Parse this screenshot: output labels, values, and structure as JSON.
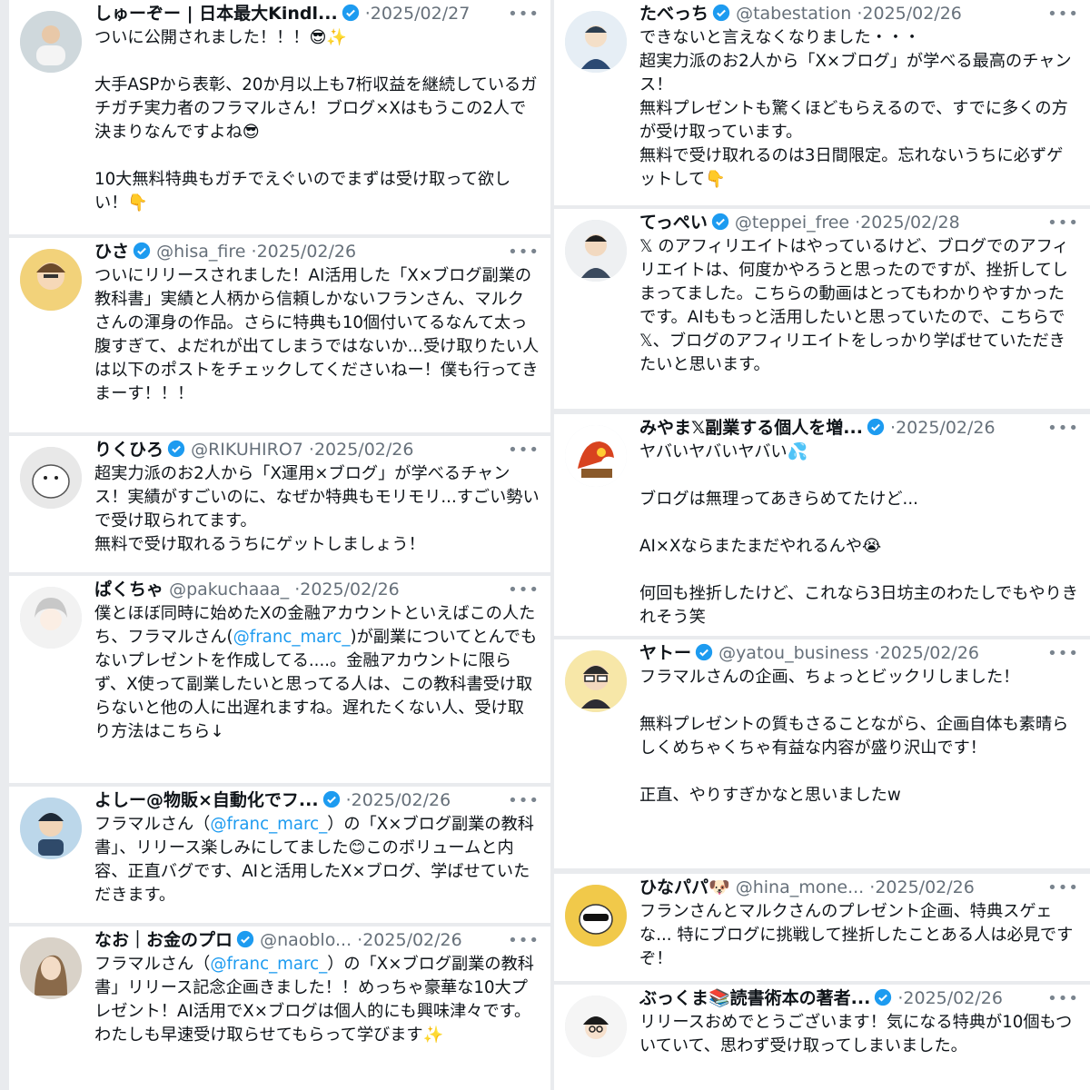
{
  "colors": {
    "verified": "#1d9bf0",
    "mention": "#1d9bf0",
    "muted": "#66707a",
    "background": "#e9ebee"
  },
  "more_icon": "•••",
  "left_tweets": [
    {
      "name": "しゅーぞー | 日本最大Kindl...",
      "handle": "",
      "dot": "·",
      "date": "2025/02/27",
      "body": "ついに公開されました！！！😎✨\n\n大手ASPから表彰、20か月以上も7桁収益を継続しているガチガチ実力者のフラマルさん！ブログ×Xはもうこの2人で決まりなんですよね😎\n\n10大無料特典もガチでえぐいのでまずは受け取って欲しい！👇"
    },
    {
      "name": "ひさ",
      "handle": "@hisa_fire",
      "dot": "·",
      "date": "2025/02/26",
      "body": "ついにリリースされました！AI活用した「X×ブログ副業の教科書」実績と人柄から信頼しかないフランさん、マルクさんの渾身の作品。さらに特典も10個付いてるなんて太っ腹すぎて、よだれが出てしまうではないか...受け取りたい人は以下のポストをチェックしてくださいねー！僕も行ってきまーす！！！"
    },
    {
      "name": "りくひろ",
      "handle": "@RIKUHIRO7",
      "dot": "·",
      "date": "2025/02/26",
      "body": "超実力派のお2人から「X運用×ブログ」が学べるチャンス！実績がすごいのに、なぜか特典もモリモリ...すごい勢いで受け取られてます。\n無料で受け取れるうちにゲットしましょう！"
    },
    {
      "name": "ぱくちゃ",
      "handle": "@pakuchaaa_",
      "dot": "·",
      "date": "2025/02/26",
      "body_pre": "僕とほぼ同時に始めたXの金融アカウントといえばこの人たち、フラマルさん(",
      "body_mention": "@franc_marc_",
      "body_post": ")が副業についてとんでもないプレゼントを作成してる....。金融アカウントに限らず、X使って副業したいと思ってる人は、この教科書受け取らないと他の人に出遅れますね。遅れたくない人、受け取り方法はこちら↓"
    },
    {
      "name": "よしー@物販×自動化でフ...",
      "handle": "",
      "dot": "·",
      "date": "2025/02/26",
      "body_pre": "フラマルさん（",
      "body_mention": "@franc_marc_",
      "body_post": "）の「X×ブログ副業の教科書」、リリース楽しみにしてました😊このボリュームと内容、正直バグです、AIと活用したX×ブログ、学ばせていただきます。"
    },
    {
      "name": "なお｜お金のプロ",
      "handle": "@naoblo...",
      "dot": "·",
      "date": "2025/02/26",
      "body_pre": "フラマルさん（",
      "body_mention": "@franc_marc_",
      "body_post": "）の「X×ブログ副業の教科書」リリース記念企画きました！！めっちゃ豪華な10大プレゼント！AI活用でX×ブログは個人的にも興味津々です。わたしも早速受け取らせてもらって学びます✨"
    }
  ],
  "right_tweets": [
    {
      "name": "たべっち",
      "handle": "@tabestation",
      "dot": "·",
      "date": "2025/02/26",
      "body": "できないと言えなくなりました・・・\n超実力派のお2人から「X×ブログ」が学べる最高のチャンス！\n無料プレゼントも驚くほどもらえるので、すでに多くの方が受け取っています。\n無料で受け取れるのは3日間限定。忘れないうちに必ずゲットして👇"
    },
    {
      "name": "てっぺい",
      "handle": "@teppei_free",
      "dot": "·",
      "date": "2025/02/28",
      "body": "𝕏 のアフィリエイトはやっているけど、ブログでのアフィリエイトは、何度かやろうと思ったのですが、挫折してしまってました。こちらの動画はとってもわかりやすかったです。AIももっと活用したいと思っていたので、こちらで𝕏、ブログのアフィリエイトをしっかり学ばせていただきたいと思います。"
    },
    {
      "name": "みやま𝕏副業する個人を増...",
      "handle": "",
      "dot": "·",
      "date": "2025/02/26",
      "body": "ヤバいヤバいヤバい💦\n\nブログは無理ってあきらめてたけど...\n\nAI×Xならまたまだやれるんや😭\n\n何回も挫折したけど、これなら3日坊主のわたしでもやりきれそう笑"
    },
    {
      "name": "ヤトー",
      "handle": "@yatou_business",
      "dot": "·",
      "date": "2025/02/26",
      "body": "フラマルさんの企画、ちょっとビックリしました！\n\n無料プレゼントの質もさることながら、企画自体も素晴らしくめちゃくちゃ有益な内容が盛り沢山です！\n\n正直、やりすぎかなと思いましたw"
    },
    {
      "name": "ひなパパ🐶",
      "handle": "@hina_mone...",
      "dot": "·",
      "date": "2025/02/26",
      "body": "フランさんとマルクさんのプレゼント企画、特典スゲェな... 特にブログに挑戦して挫折したことある人は必見ですぞ！"
    },
    {
      "name": "ぶっくま📚読書術本の著者...",
      "handle": "",
      "dot": "·",
      "date": "2025/02/26",
      "body": "リリースおめでとうございます！気になる特典が10個もついていて、思わず受け取ってしまいました。"
    }
  ]
}
